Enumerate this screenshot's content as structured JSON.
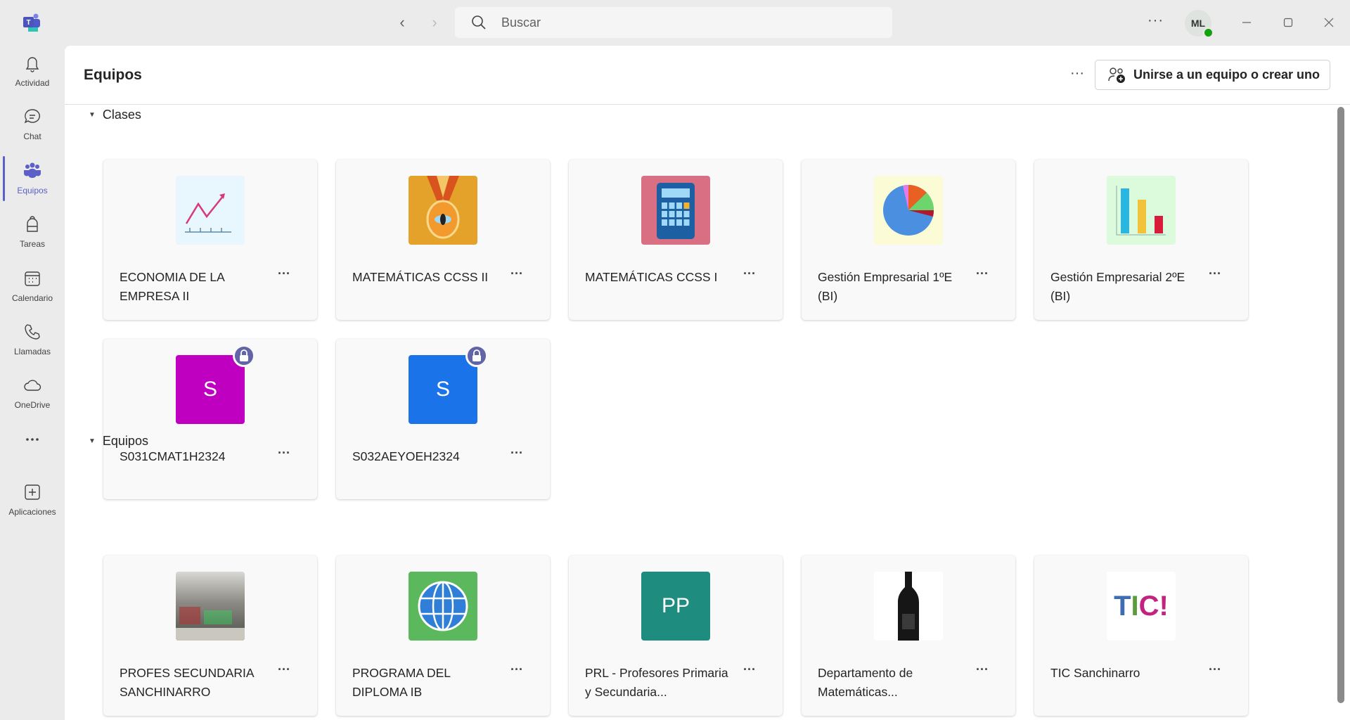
{
  "topbar": {
    "search_placeholder": "Buscar",
    "avatar_initials": "ML",
    "more_label": "···"
  },
  "sidebar": {
    "items": [
      {
        "label": "Actividad",
        "icon": "bell-icon"
      },
      {
        "label": "Chat",
        "icon": "chat-icon"
      },
      {
        "label": "Equipos",
        "icon": "teams-icon",
        "active": true
      },
      {
        "label": "Tareas",
        "icon": "backpack-icon"
      },
      {
        "label": "Calendario",
        "icon": "calendar-icon"
      },
      {
        "label": "Llamadas",
        "icon": "phone-icon"
      },
      {
        "label": "OneDrive",
        "icon": "cloud-icon"
      },
      {
        "label": "",
        "icon": "more-icon"
      },
      {
        "label": "Aplicaciones",
        "icon": "add-apps-icon"
      }
    ]
  },
  "header": {
    "title": "Equipos",
    "more_label": "···",
    "join_button": "Unirse a un equipo o crear uno"
  },
  "colors": {
    "accent": "#5b5fc7",
    "presence": "#13a10e"
  },
  "sections": [
    {
      "label": "Clases",
      "cards": [
        {
          "name": "ECONOMIA DE LA EMPRESA II",
          "icon": "line-chart",
          "bg": "#e8f6fd"
        },
        {
          "name": "MATEMÁTICAS CCSS II",
          "icon": "medal",
          "bg": "#e5a22b"
        },
        {
          "name": "MATEMÁTICAS CCSS I",
          "icon": "calculator",
          "bg": "#d96f82"
        },
        {
          "name": "Gestión Empresarial 1ºE (BI)",
          "icon": "pie-chart",
          "bg": "#fbfbd6"
        },
        {
          "name": "Gestión Empresarial 2ºE (BI)",
          "icon": "bar-chart",
          "bg": "#dcfadc"
        },
        {
          "name": "S031CMAT1H2324",
          "icon": "initials",
          "initials": "S",
          "bg": "#c000c0",
          "locked": true
        },
        {
          "name": "S032AEYOEH2324",
          "icon": "initials",
          "initials": "S",
          "bg": "#1a73e8",
          "locked": true
        }
      ]
    },
    {
      "label": "Equipos",
      "cards": [
        {
          "name": "PROFES SECUNDARIA SANCHINARRO",
          "icon": "photo",
          "bg": "#8b8f8a"
        },
        {
          "name": "PROGRAMA DEL DIPLOMA IB",
          "icon": "globe",
          "bg": "#5cb85c"
        },
        {
          "name": "PRL - Profesores Primaria y Secundaria...",
          "icon": "initials",
          "initials": "PP",
          "bg": "#1e8c7e"
        },
        {
          "name": "Departamento de Matemáticas...",
          "icon": "bottle",
          "bg": "#ffffff"
        },
        {
          "name": "TIC Sanchinarro",
          "icon": "tic-logo",
          "logo_text": "TIC!",
          "bg": "#ffffff"
        }
      ]
    }
  ]
}
